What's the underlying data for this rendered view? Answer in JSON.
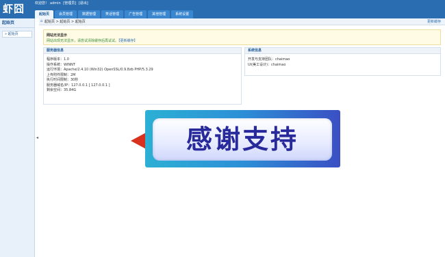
{
  "header": {
    "logo": "虾囧",
    "welcome_prefix": "欢迎您！",
    "username": "admin",
    "role": "[管理员]",
    "logout": "[退出]",
    "tabs": [
      {
        "label": "起始页",
        "active": true
      },
      {
        "label": "会员管理",
        "active": false
      },
      {
        "label": "数据管理",
        "active": false
      },
      {
        "label": "笑话管理",
        "active": false
      },
      {
        "label": "广告管理",
        "active": false
      },
      {
        "label": "其他管理",
        "active": false
      },
      {
        "label": "系统设置",
        "active": false
      }
    ]
  },
  "sidebar": {
    "title": "起始页",
    "items": [
      {
        "label": "» 起始页"
      }
    ]
  },
  "breadcrumb": {
    "text": "起始页 > 起始页 > 起始页",
    "right_link": "更新缓存"
  },
  "notice": {
    "title": "网站无法显示",
    "text": "网站出现无法显示，请尝试清除缓存后再试试。",
    "link": "【更新缓存】"
  },
  "server_panel": {
    "title": "服务器信息",
    "rows": [
      "程序版本：1.0",
      "操作系统：WINNT",
      "运行环境：Apache/2.4.10 (Win32) OpenSSL/0.9.8zb PHP/5.3.29",
      "上传附件限制：2M",
      "执行时间限制：30秒",
      "服务器域名/IP：127.0.0.1 [ 127.0.0.1 ]",
      "剩余空间：35.84G"
    ]
  },
  "dev_panel": {
    "title": "系统信息",
    "rows": [
      "开发与支持团队：chaimao",
      "UI(美工设计)：chaimao"
    ]
  },
  "banner": {
    "text": "感谢支持"
  },
  "colors": {
    "header": "#2a6db0",
    "tab": "#3a86cf",
    "accent": "#1e5a96",
    "arrow": "#d8321f",
    "banner_text": "#28299a"
  }
}
